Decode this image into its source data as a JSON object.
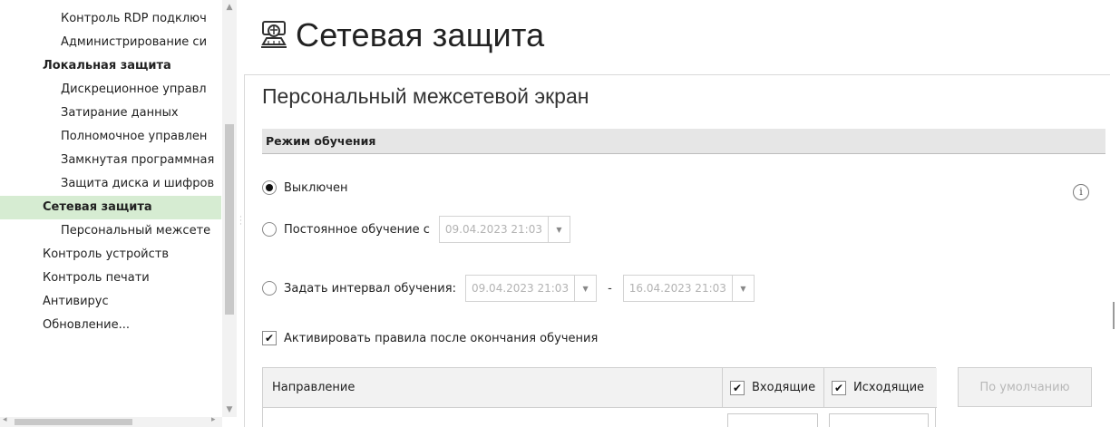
{
  "sidebar": {
    "items": [
      {
        "label": "Контроль RDP подключ",
        "level": "child",
        "bold": false,
        "selected": false
      },
      {
        "label": "Администрирование си",
        "level": "child",
        "bold": false,
        "selected": false
      },
      {
        "label": "Локальная защита",
        "level": "root",
        "bold": true,
        "selected": false
      },
      {
        "label": "Дискреционное управл",
        "level": "child",
        "bold": false,
        "selected": false
      },
      {
        "label": "Затирание данных",
        "level": "child",
        "bold": false,
        "selected": false
      },
      {
        "label": "Полномочное управлен",
        "level": "child",
        "bold": false,
        "selected": false
      },
      {
        "label": "Замкнутая программная",
        "level": "child",
        "bold": false,
        "selected": false
      },
      {
        "label": "Защита диска и шифров",
        "level": "child",
        "bold": false,
        "selected": false
      },
      {
        "label": "Сетевая защита",
        "level": "root",
        "bold": true,
        "selected": true
      },
      {
        "label": "Персональный межсете",
        "level": "child",
        "bold": false,
        "selected": false
      },
      {
        "label": "Контроль устройств",
        "level": "root",
        "bold": false,
        "selected": false
      },
      {
        "label": "Контроль печати",
        "level": "root",
        "bold": false,
        "selected": false
      },
      {
        "label": "Антивирус",
        "level": "root",
        "bold": false,
        "selected": false
      },
      {
        "label": "Обновление...",
        "level": "root",
        "bold": false,
        "selected": false
      }
    ],
    "top_partial": "..."
  },
  "page": {
    "title": "Сетевая защита",
    "icon": "network-protection-icon"
  },
  "panel": {
    "title": "Персональный межсетевой экран",
    "section_title": "Режим обучения",
    "learning_mode": {
      "selected": "off",
      "off_label": "Выключен",
      "permanent_label": "Постоянное обучение с",
      "permanent_date": "09.04.2023 21:03",
      "interval_label": "Задать интервал обучения:",
      "interval_from": "09.04.2023 21:03",
      "interval_dash": "-",
      "interval_to": "16.04.2023 21:03"
    },
    "activate_rules": {
      "checked": true,
      "label": "Активировать правила после окончания обучения"
    },
    "table": {
      "col_direction": "Направление",
      "col_incoming": "Входящие",
      "col_incoming_checked": true,
      "col_outgoing": "Исходящие",
      "col_outgoing_checked": true
    },
    "default_button": "По умолчанию",
    "info_glyph": "i"
  },
  "colors": {
    "selected_bg": "#d6ecd2",
    "section_bg": "#e6e6e6",
    "disabled_text": "#b3b3b3"
  }
}
